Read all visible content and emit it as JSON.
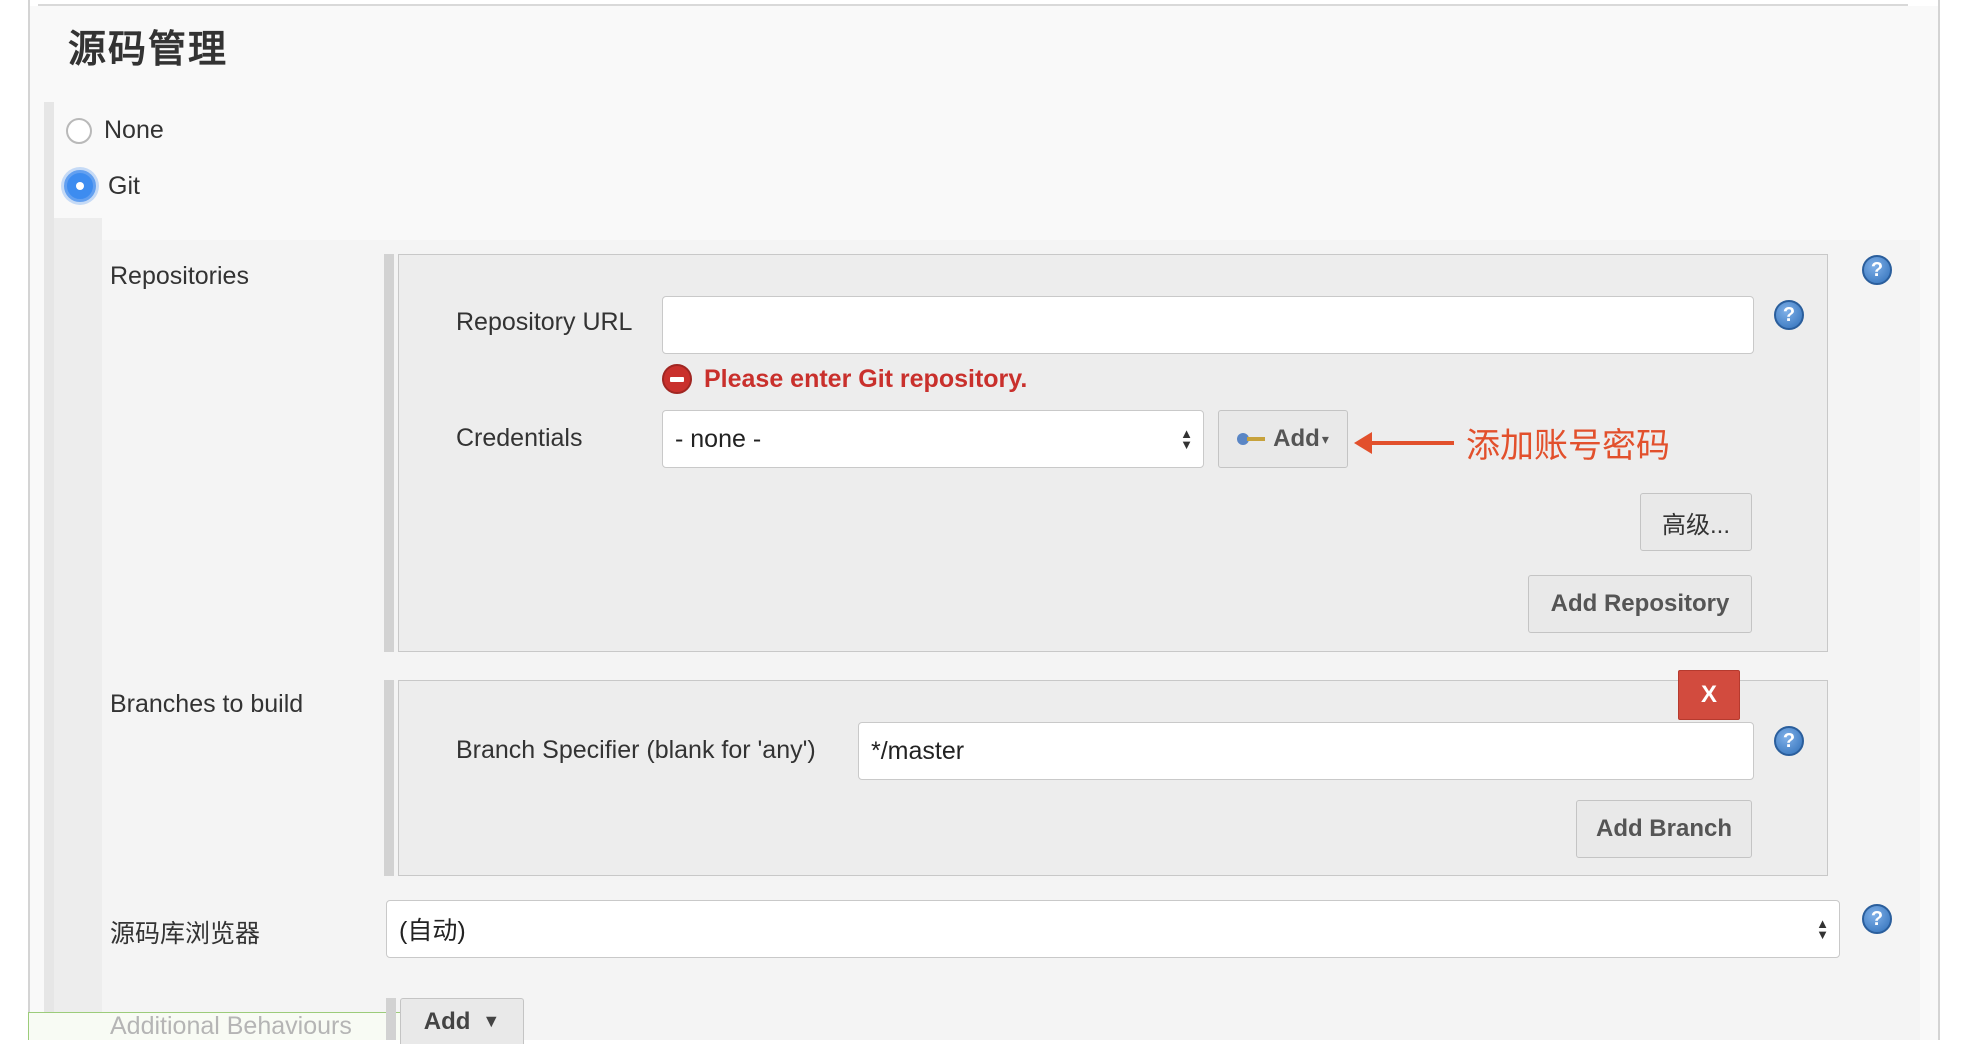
{
  "section": {
    "title": "源码管理"
  },
  "scm_options": [
    {
      "label": "None",
      "checked": false
    },
    {
      "label": "Git",
      "checked": true
    }
  ],
  "repositories": {
    "label": "Repositories",
    "url_label": "Repository URL",
    "url_value": "",
    "error": "Please enter Git repository.",
    "credentials_label": "Credentials",
    "credentials_value": "- none -",
    "add_label": "Add",
    "advanced_label": "高级...",
    "add_repository_label": "Add Repository"
  },
  "annotation": {
    "text": "添加账号密码",
    "color": "#e2502c"
  },
  "branches": {
    "label": "Branches to build",
    "delete_label": "X",
    "specifier_label": "Branch Specifier (blank for 'any')",
    "specifier_value": "*/master",
    "add_branch_label": "Add Branch"
  },
  "browser": {
    "label": "源码库浏览器",
    "value": "(自动)"
  },
  "behaviours": {
    "label": "Additional Behaviours",
    "add_label": "Add"
  },
  "icons": {
    "help": "help-icon",
    "error": "error-icon",
    "key": "key-icon",
    "select": "select-arrows-icon",
    "dropdown": "caret-down-icon"
  },
  "colors": {
    "error": "#c9302c",
    "delete": "#d24b3e",
    "radio_checked": "#3d8cf0"
  }
}
